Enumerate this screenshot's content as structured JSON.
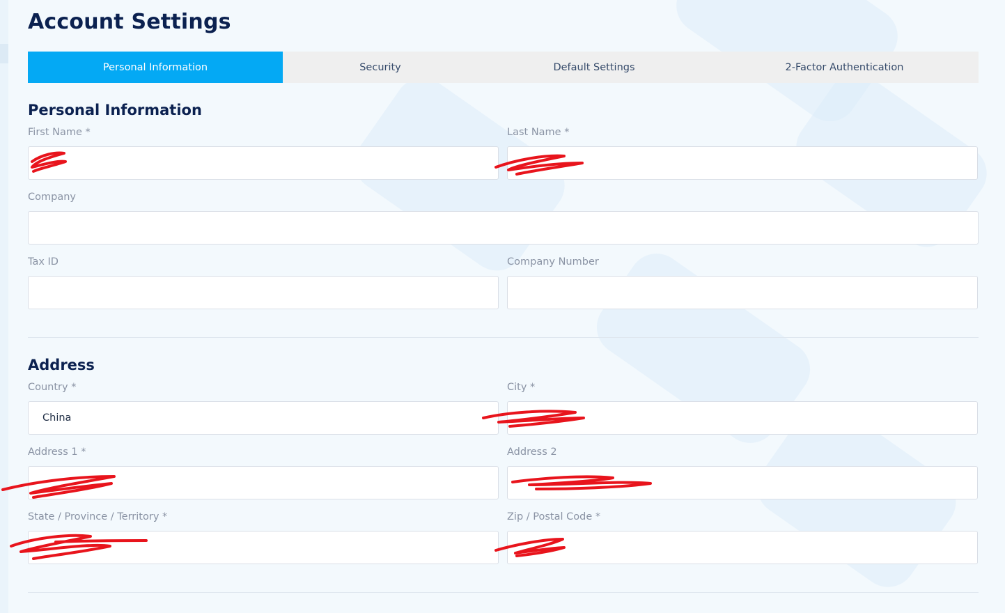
{
  "page": {
    "title": "Account Settings"
  },
  "tabs": [
    {
      "label": "Personal Information",
      "active": true
    },
    {
      "label": "Security",
      "active": false
    },
    {
      "label": "Default Settings",
      "active": false
    },
    {
      "label": "2-Factor Authentication",
      "active": false
    }
  ],
  "personal": {
    "heading": "Personal Information",
    "first_name": {
      "label": "First Name *",
      "value": ""
    },
    "last_name": {
      "label": "Last Name *",
      "value": ""
    },
    "company": {
      "label": "Company",
      "value": ""
    },
    "tax_id": {
      "label": "Tax ID",
      "value": ""
    },
    "company_number": {
      "label": "Company Number",
      "value": ""
    }
  },
  "address": {
    "heading": "Address",
    "country": {
      "label": "Country *",
      "value": "China"
    },
    "city": {
      "label": "City *",
      "value": ""
    },
    "address1": {
      "label": "Address 1 *",
      "value": ""
    },
    "address2": {
      "label": "Address 2",
      "value": ""
    },
    "state": {
      "label": "State / Province / Territory *",
      "value": ""
    },
    "zip": {
      "label": "Zip / Postal Code *",
      "value": ""
    }
  },
  "colors": {
    "accent": "#04a9f4",
    "title": "#0b2150",
    "label": "#8a93a4",
    "redaction": "#e8141c"
  }
}
